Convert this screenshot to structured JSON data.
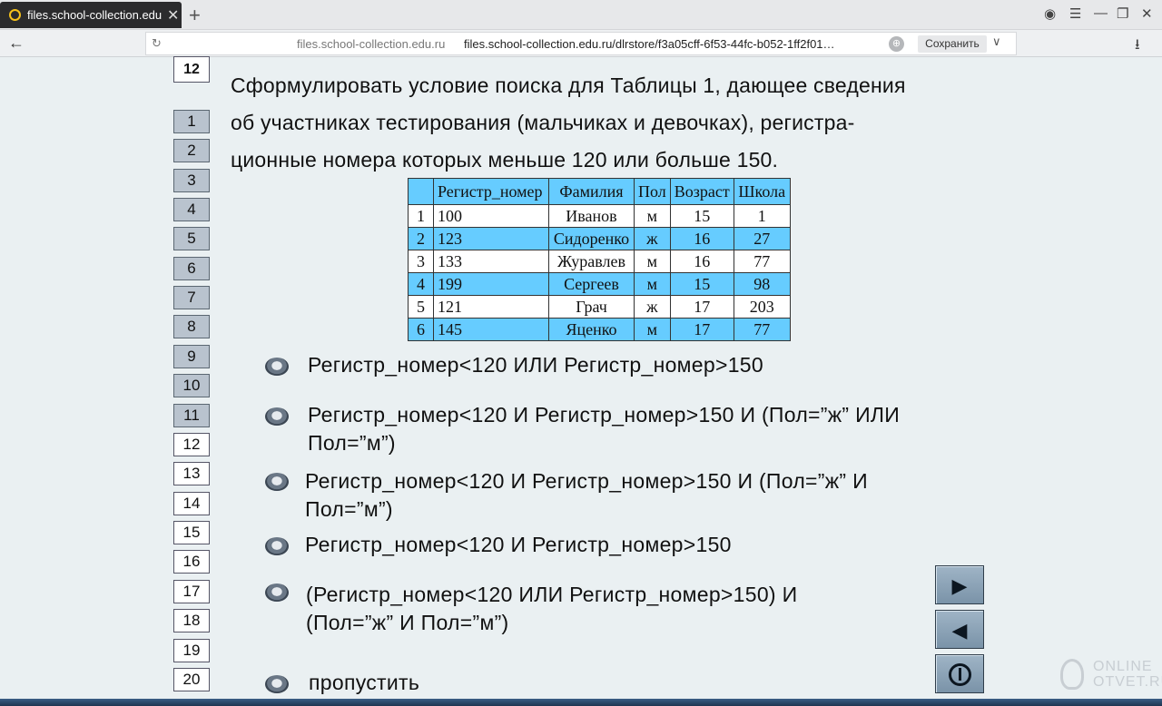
{
  "browser": {
    "tab_title": "files.school-collection.edu",
    "host": "files.school-collection.edu.ru",
    "url": "files.school-collection.edu.ru/dlrstore/f3a05cff-6f53-44fc-b052-1ff2f01…",
    "save_label": "Сохранить"
  },
  "current_question": "12",
  "question_numbers": [
    "1",
    "2",
    "3",
    "4",
    "5",
    "6",
    "7",
    "8",
    "9",
    "10",
    "11",
    "12",
    "13",
    "14",
    "15",
    "16",
    "17",
    "18",
    "19",
    "20"
  ],
  "question_lines": [
    "Сформулировать условие поиска для Таблицы 1, дающее сведения",
    "об участниках тестирования (мальчиках и девочках), регистра-",
    "ционные номера которых меньше 120 или больше 150."
  ],
  "table": {
    "headers": [
      "",
      "Регистр_номер",
      "Фамилия",
      "Пол",
      "Возраст",
      "Школа"
    ],
    "rows": [
      [
        "1",
        "100",
        "Иванов",
        "м",
        "15",
        "1"
      ],
      [
        "2",
        "123",
        "Сидоренко",
        "ж",
        "16",
        "27"
      ],
      [
        "3",
        "133",
        "Журавлев",
        "м",
        "16",
        "77"
      ],
      [
        "4",
        "199",
        "Сергеев",
        "м",
        "15",
        "98"
      ],
      [
        "5",
        "121",
        "Грач",
        "ж",
        "17",
        "203"
      ],
      [
        "6",
        "145",
        "Яценко",
        "м",
        "17",
        "77"
      ]
    ]
  },
  "options": [
    {
      "line1": "Регистр_номер<120 ИЛИ Регистр_номер>150",
      "line2": ""
    },
    {
      "line1": "Регистр_номер<120 И Регистр_номер>150 И (Пол=”ж” ИЛИ",
      "line2": "Пол=”м”)"
    },
    {
      "line1": "Регистр_номер<120 И Регистр_номер>150 И (Пол=”ж” И",
      "line2": "Пол=”м”)"
    },
    {
      "line1": "Регистр_номер<120 И Регистр_номер>150",
      "line2": ""
    },
    {
      "line1": "(Регистр_номер<120 ИЛИ Регистр_номер>150) И",
      "line2": "(Пол=”ж” И Пол=”м”)"
    },
    {
      "line1": "пропустить",
      "line2": ""
    }
  ],
  "watermark": {
    "line1": "ONLINE",
    "line2": "OTVET.RU"
  }
}
